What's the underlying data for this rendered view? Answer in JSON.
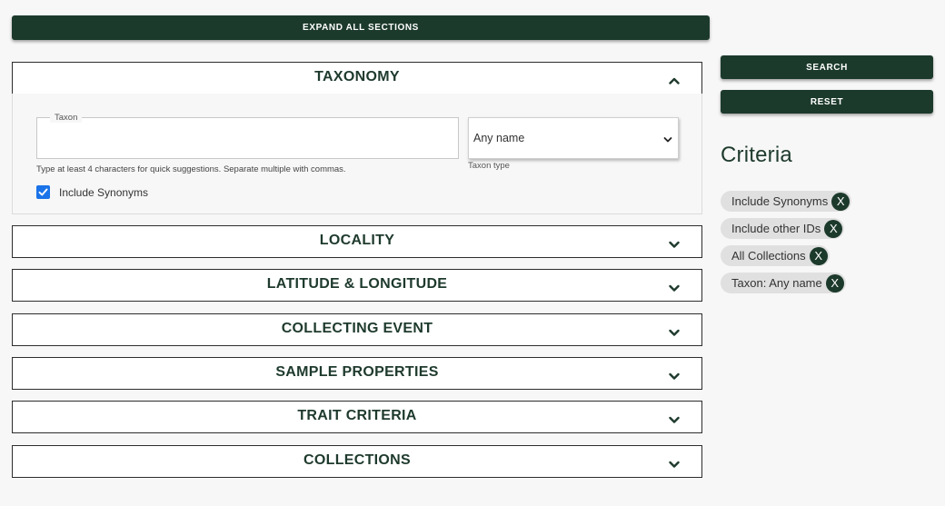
{
  "toolbar": {
    "expand_all_label": "EXPAND ALL SECTIONS",
    "search_label": "SEARCH",
    "reset_label": "RESET"
  },
  "sections": [
    {
      "title": "TAXONOMY",
      "expanded": true
    },
    {
      "title": "LOCALITY",
      "expanded": false
    },
    {
      "title": "LATITUDE & LONGITUDE",
      "expanded": false
    },
    {
      "title": "COLLECTING EVENT",
      "expanded": false
    },
    {
      "title": "SAMPLE PROPERTIES",
      "expanded": false
    },
    {
      "title": "TRAIT CRITERIA",
      "expanded": false
    },
    {
      "title": "COLLECTIONS",
      "expanded": false
    }
  ],
  "taxonomy": {
    "taxon_label": "Taxon",
    "taxon_value": "",
    "helper_text": "Type at least 4 characters for quick suggestions. Separate multiple with commas.",
    "taxon_type_value": "Any name",
    "taxon_type_caption": "Taxon type",
    "include_synonyms_label": "Include Synonyms",
    "include_synonyms_checked": true
  },
  "criteria": {
    "title": "Criteria",
    "chips": [
      {
        "label": "Include Synonyms",
        "remove": "X"
      },
      {
        "label": "Include other IDs",
        "remove": "X"
      },
      {
        "label": "All Collections",
        "remove": "X"
      },
      {
        "label": "Taxon: Any name",
        "remove": "X"
      }
    ]
  },
  "colors": {
    "brand_dark_green": "#1c3a2c",
    "heading_green": "#1e3a2d",
    "checkbox_blue": "#1a73e8",
    "chip_bg": "#e0e0e0"
  }
}
